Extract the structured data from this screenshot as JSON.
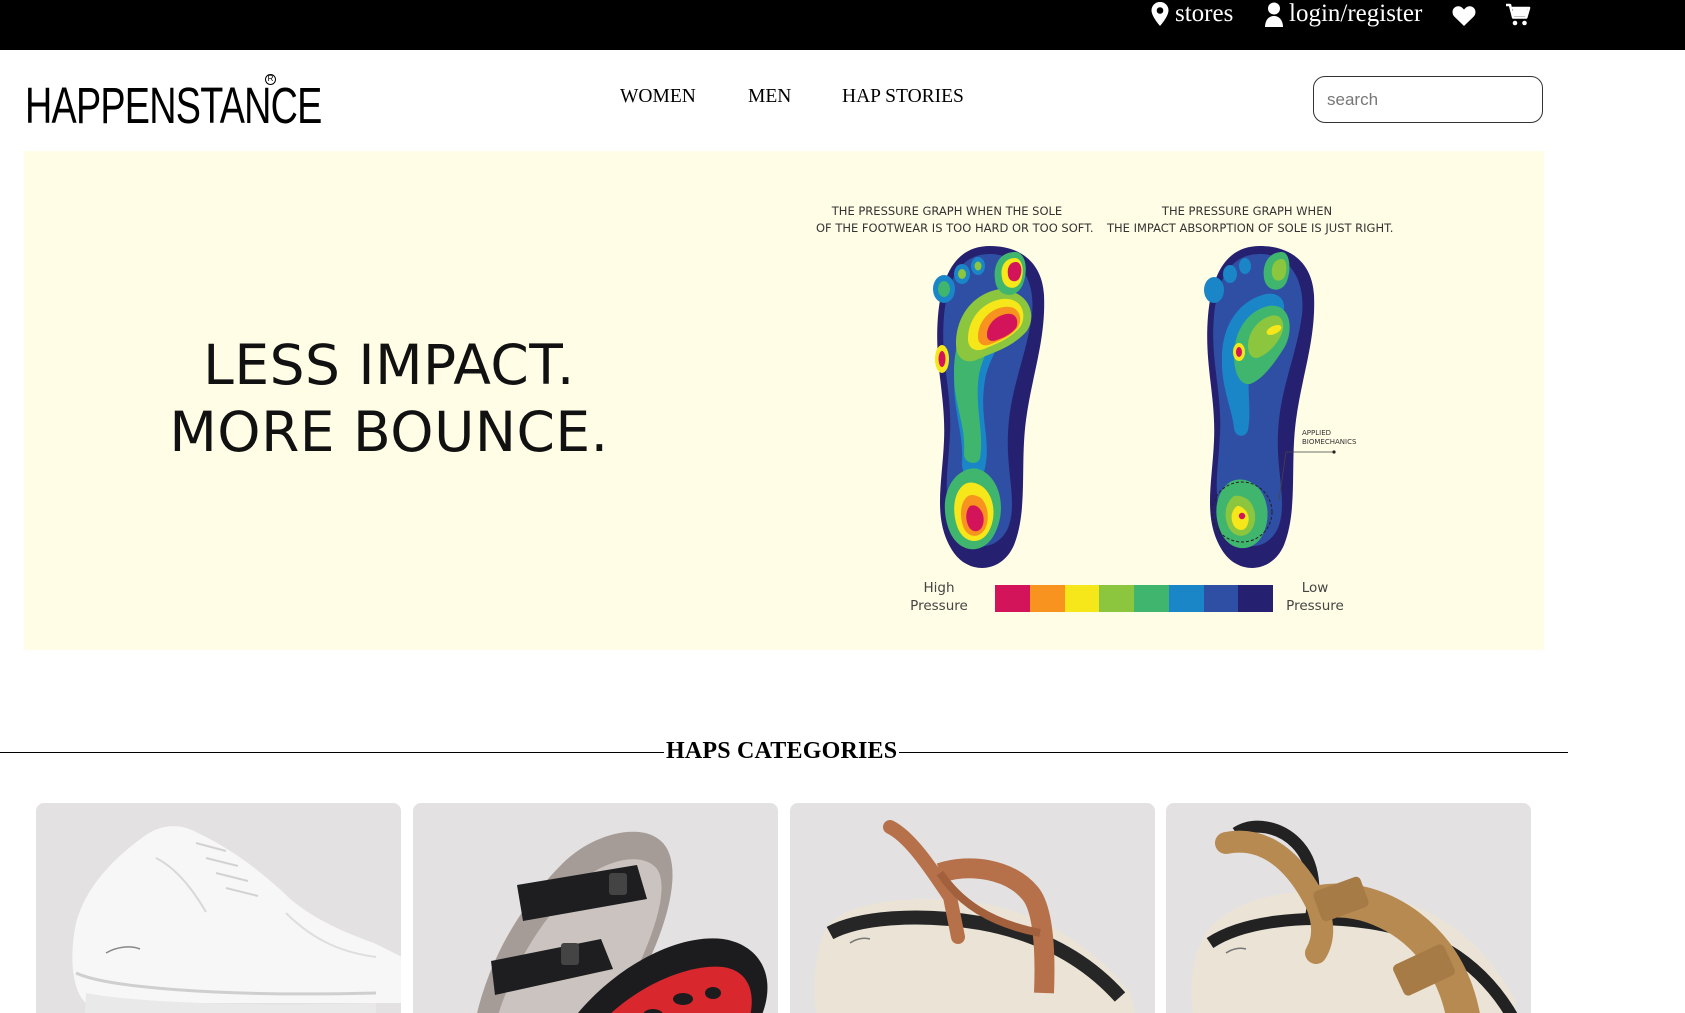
{
  "topbar": {
    "stores_label": "stores",
    "login_label": "login/register",
    "icons": [
      "location-pin-icon",
      "user-icon",
      "heart-icon",
      "cart-icon"
    ]
  },
  "header": {
    "logo_text": "HAPPENSTANCE",
    "logo_mark": "R",
    "nav": [
      {
        "label": "WOMEN"
      },
      {
        "label": "MEN"
      },
      {
        "label": "HAP STORIES"
      }
    ],
    "search_placeholder": "search"
  },
  "banner": {
    "headline_line1": "LESS IMPACT.",
    "headline_line2": "MORE BOUNCE.",
    "graph_left_caption_line1": "THE PRESSURE GRAPH WHEN THE SOLE",
    "graph_left_caption_line2": "OF THE FOOTWEAR IS TOO HARD OR TOO SOFT.",
    "graph_right_caption_line1": "THE PRESSURE GRAPH WHEN",
    "graph_right_caption_line2": "THE IMPACT ABSORPTION OF SOLE IS JUST RIGHT.",
    "annotation_line1": "APPLIED",
    "annotation_line2": "BIOMECHANICS",
    "legend_high_line1": "High",
    "legend_high_line2": "Pressure",
    "legend_low_line1": "Low",
    "legend_low_line2": "Pressure",
    "pressure_scale_colors": [
      "#d4145a",
      "#f7931e",
      "#f5e71a",
      "#8cc63f",
      "#3fb56e",
      "#1a86c8",
      "#2e4fa3",
      "#262070"
    ],
    "background_color": "#fffde5"
  },
  "categories": {
    "title": "HAPS CATEGORIES",
    "items": [
      {
        "image": "white-sneaker"
      },
      {
        "image": "black-buckle-slide-sandal"
      },
      {
        "image": "tan-thong-sandal"
      },
      {
        "image": "tan-strap-sandal"
      }
    ]
  }
}
